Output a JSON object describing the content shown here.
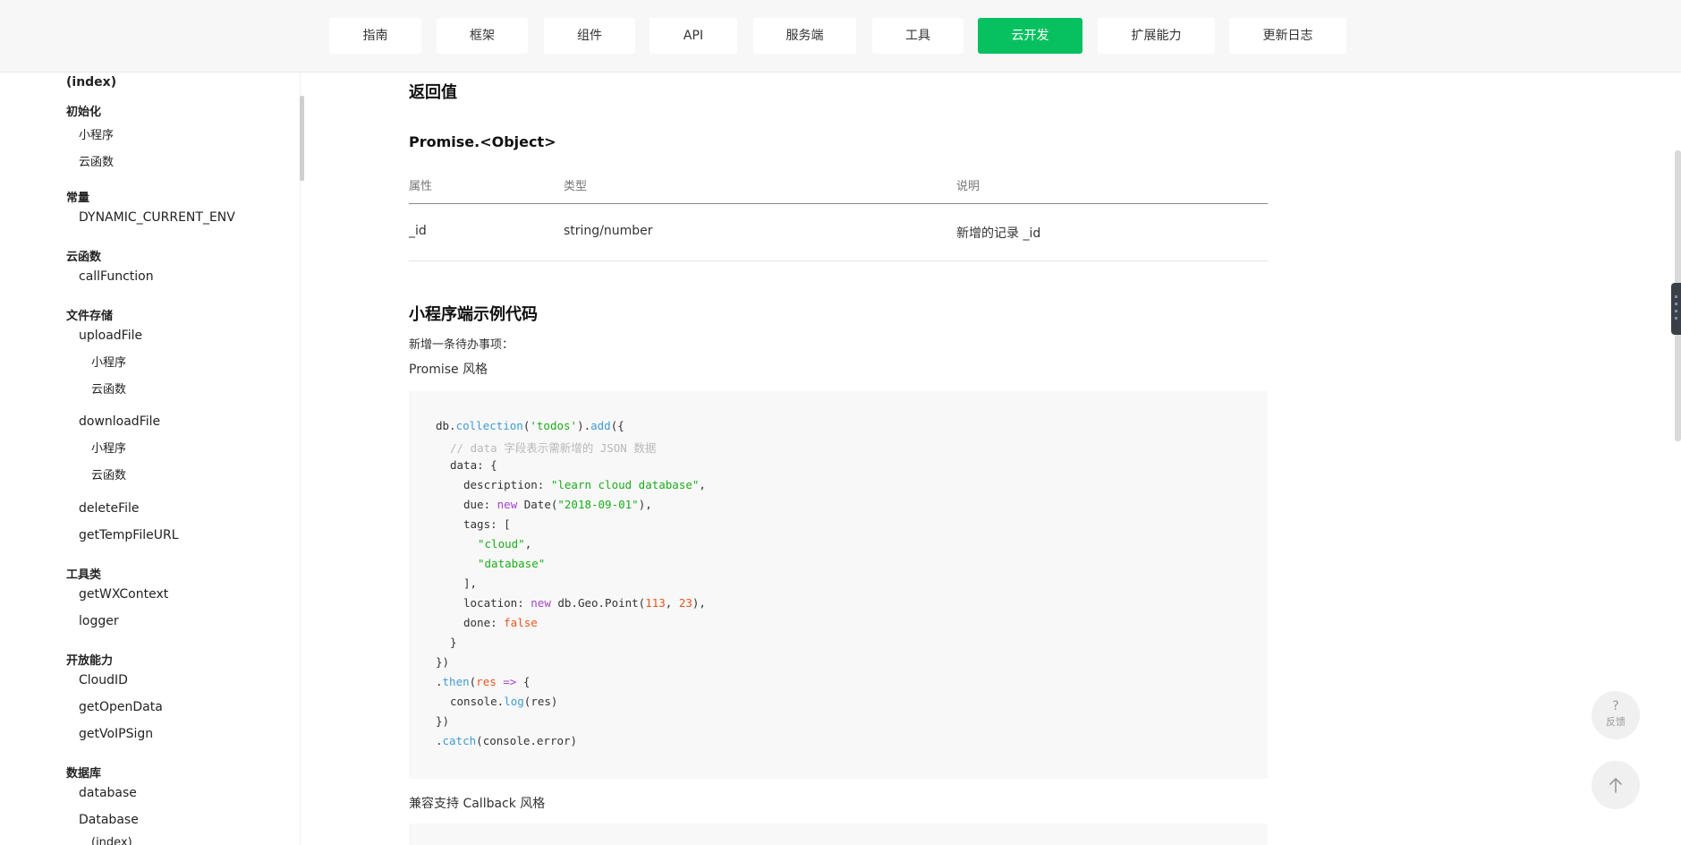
{
  "nav": {
    "items": [
      "指南",
      "框架",
      "组件",
      "API",
      "服务端",
      "工具",
      "云开发",
      "扩展能力",
      "更新日志"
    ],
    "active": "云开发"
  },
  "sidebar": {
    "index_top": "(index)",
    "init": {
      "group": "初始化",
      "items": [
        "小程序",
        "云函数"
      ]
    },
    "const": {
      "group": "常量",
      "items": [
        "DYNAMIC_CURRENT_ENV"
      ]
    },
    "cloudfn": {
      "group": "云函数",
      "items": [
        "callFunction"
      ]
    },
    "storage": {
      "group": "文件存储",
      "upload": "uploadFile",
      "upload_sub": [
        "小程序",
        "云函数"
      ],
      "download": "downloadFile",
      "download_sub": [
        "小程序",
        "云函数"
      ],
      "delete": "deleteFile",
      "temp": "getTempFileURL"
    },
    "tools": {
      "group": "工具类",
      "items": [
        "getWXContext",
        "logger"
      ]
    },
    "open": {
      "group": "开放能力",
      "items": [
        "CloudID",
        "getOpenData",
        "getVoIPSign"
      ]
    },
    "db": {
      "group": "数据库",
      "items": [
        "database",
        "Database"
      ],
      "sub": "(index)"
    }
  },
  "content": {
    "return_heading": "返回值",
    "promise_heading": "Promise.<Object>",
    "table": {
      "headers": [
        "属性",
        "类型",
        "说明"
      ],
      "rows": [
        [
          "_id",
          "string/number",
          "新增的记录 _id"
        ]
      ]
    },
    "sample_heading": "小程序端示例代码",
    "desc": "新增一条待办事项：",
    "style1": "Promise 风格",
    "style2": "兼容支持 Callback 风格",
    "code": {
      "l1_db": "db.",
      "l1_collection": "collection",
      "l1_open": "(",
      "l1_str": "'todos'",
      "l1_close": ").",
      "l1_add": "add",
      "l1_end": "({",
      "l2_comment": "// data 字段表示需新增的 JSON 数据",
      "l3": "data: {",
      "l4_key": "description: ",
      "l4_str": "\"learn cloud database\"",
      "l4_end": ",",
      "l5_key": "due: ",
      "l5_new": "new",
      "l5_date": " Date(",
      "l5_str": "\"2018-09-01\"",
      "l5_end": "),",
      "l6": "tags: [",
      "l7_str": "\"cloud\"",
      "l7_end": ",",
      "l8_str": "\"database\"",
      "l9": "],",
      "l10_key": "location: ",
      "l10_new": "new",
      "l10_geo": " db.Geo.Point(",
      "l10_n1": "113",
      "l10_sep": ", ",
      "l10_n2": "23",
      "l10_end": "),",
      "l11_key": "done: ",
      "l11_val": "false",
      "l12": "}",
      "l13": "})",
      "l14_dot": ".",
      "l14_then": "then",
      "l14_open": "(",
      "l14_res": "res",
      "l14_arrow": " =>",
      "l14_end": " {",
      "l15_a": "console.",
      "l15_log": "log",
      "l15_b": "(res)",
      "l16": "})",
      "l17_dot": ".",
      "l17_catch": "catch",
      "l17_end": "(console.error)"
    }
  },
  "widgets": {
    "feedback_icon": "?",
    "feedback_label": "反馈",
    "back_to_top": "arrow-up-icon"
  },
  "colors": {
    "accent": "#07c160",
    "code_key": "#3f9bd5",
    "code_string": "#1aad19",
    "code_keyword": "#a344c9",
    "code_number": "#e8561e"
  }
}
